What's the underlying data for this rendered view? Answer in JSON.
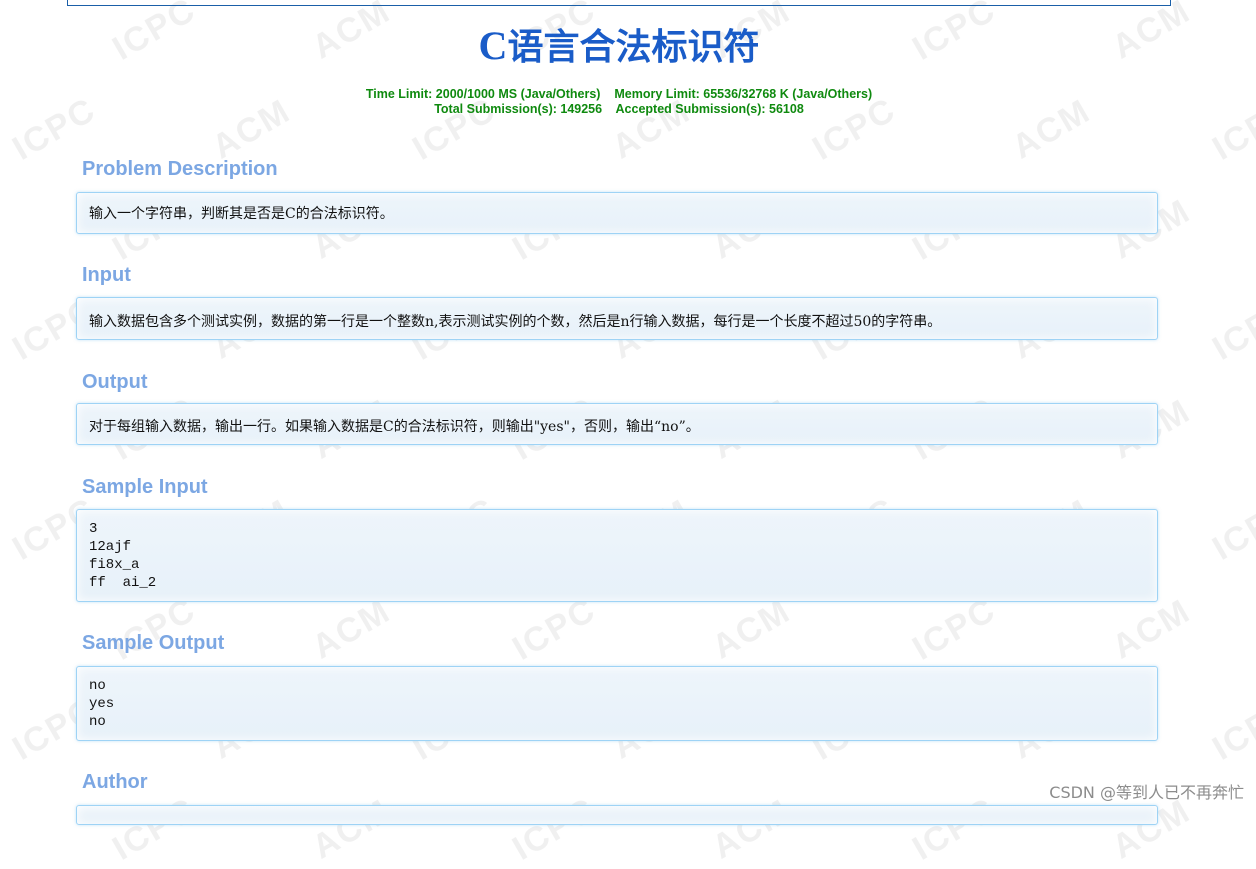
{
  "problem": {
    "title_lead": "C",
    "title_rest": "语言合法标识符",
    "limits_line1": "Time Limit: 2000/1000 MS (Java/Others)    Memory Limit: 65536/32768 K (Java/Others)",
    "limits_line2": "Total Submission(s): 149256    Accepted Submission(s): 56108"
  },
  "sections": {
    "description": {
      "title": "Problem Description",
      "text": "输入一个字符串，判断其是否是C的合法标识符。"
    },
    "input": {
      "title": "Input",
      "text": "输入数据包含多个测试实例，数据的第一行是一个整数n,表示测试实例的个数，然后是n行输入数据，每行是一个长度不超过50的字符串。"
    },
    "output": {
      "title": "Output",
      "text": "对于每组输入数据，输出一行。如果输入数据是C的合法标识符，则输出\"yes\"，否则，输出“no”。"
    },
    "sample_input": {
      "title": "Sample Input",
      "text": "3\n12ajf\nfi8x_a\nff  ai_2"
    },
    "sample_output": {
      "title": "Sample Output",
      "text": "no\nyes\nno"
    },
    "author": {
      "title": "Author"
    }
  },
  "watermark": {
    "texts": [
      "ACM",
      "ICPC"
    ]
  },
  "footer": {
    "csdn_credit": "CSDN @等到人已不再奔忙"
  },
  "colors": {
    "title": "#1a5cc8",
    "limits": "#0f8a0f",
    "section_heading": "#7ca7e3",
    "panel_border": "#9ed3f5",
    "panel_bg": "#eaf3fa"
  }
}
